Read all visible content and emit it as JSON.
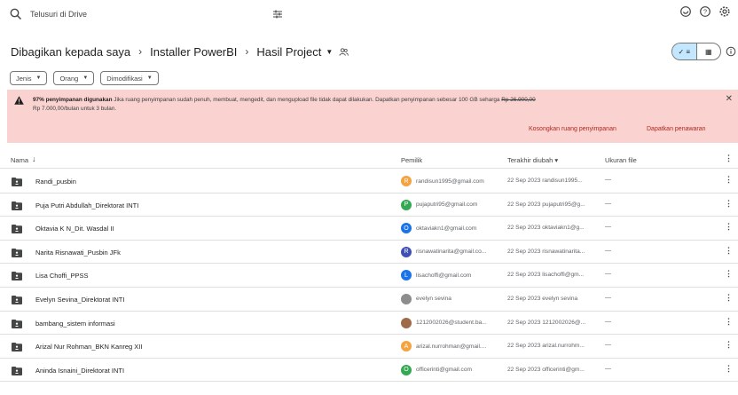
{
  "search": {
    "placeholder": "Telusuri di Drive",
    "icon": "search-icon",
    "filter_icon": "tune-icon"
  },
  "topbar": {
    "icons": [
      "offline-status-icon",
      "help-icon",
      "settings-icon"
    ]
  },
  "breadcrumb": {
    "items": [
      "Dibagikan kepada saya",
      "Installer PowerBI",
      "Hasil Project"
    ],
    "separator": "›"
  },
  "view_toggle": {
    "list_label": "✓ ≡",
    "grid_label": "▦",
    "selected": "list"
  },
  "filters": [
    {
      "label": "Jenis"
    },
    {
      "label": "Orang"
    },
    {
      "label": "Dimodifikasi"
    }
  ],
  "banner": {
    "bold": "97% penyimpanan digunakan",
    "text": " Jika ruang penyimpanan sudah penuh, membuat, mengedit, dan mengupload file tidak dapat dilakukan. Dapatkan penyimpanan sebesar 100 GB seharga ",
    "old_price": "Rp 26.900,00",
    "text2": "Rp 7.000,00/bulan untuk 3 bulan.",
    "action1": "Kosongkan ruang penyimpanan",
    "action2": "Dapatkan penawaran",
    "colors": {
      "background": "#fad2cf",
      "action": "#b3261e"
    }
  },
  "table": {
    "columns": {
      "name": "Nama",
      "owner": "Pemilik",
      "modified": "Terakhir diubah ▾",
      "size": "Ukuran file"
    },
    "rows": [
      {
        "name": "Randi_pusbin",
        "avatar_letter": "R",
        "avatar_color": "#f4a340",
        "owner": "randisun1995@gmail.com",
        "modified": "22 Sep 2023 randisun1995...",
        "size": "—"
      },
      {
        "name": "Puja Putri Abdullah_Direktorat INTI",
        "avatar_letter": "P",
        "avatar_color": "#34a853",
        "owner": "pujaputri95@gmail.com",
        "modified": "22 Sep 2023 pujaputri95@g...",
        "size": "—"
      },
      {
        "name": "Oktavia K N_Dit. Wasdal II",
        "avatar_letter": "O",
        "avatar_color": "#1a73e8",
        "owner": "oktaviakn1@gmail.com",
        "modified": "22 Sep 2023 oktaviakn1@g...",
        "size": "—"
      },
      {
        "name": "Narita Risnawati_Pusbin JFk",
        "avatar_letter": "R",
        "avatar_color": "#3f51b5",
        "owner": "risnawatinarita@gmail.co...",
        "modified": "22 Sep 2023 risnawatinarita...",
        "size": "—"
      },
      {
        "name": "Lisa Choffi_PPSS",
        "avatar_letter": "L",
        "avatar_color": "#1a73e8",
        "owner": "lisachoffi@gmail.com",
        "modified": "22 Sep 2023 lisachoffi@gm...",
        "size": "—"
      },
      {
        "name": "Evelyn Sevina_Direktorat INTI",
        "avatar_letter": "",
        "avatar_color": "#8d8d8d",
        "owner": "evelyn sevina",
        "modified": "22 Sep 2023 evelyn sevina",
        "size": "—"
      },
      {
        "name": "bambang_sistem informasi",
        "avatar_letter": "",
        "avatar_color": "#9e6b4a",
        "owner": "1212002026@student.ba...",
        "modified": "22 Sep 2023 1212002026@...",
        "size": "—"
      },
      {
        "name": "Arizal Nur Rohman_BKN Kanreg XII",
        "avatar_letter": "A",
        "avatar_color": "#f4a340",
        "owner": "arizal.nurrohman@gmail....",
        "modified": "22 Sep 2023 arizal.nurrohm...",
        "size": "—"
      },
      {
        "name": "Aninda Isnaini_Direktorat INTI",
        "avatar_letter": "O",
        "avatar_color": "#34a853",
        "owner": "officerinti@gmail.com",
        "modified": "22 Sep 2023 officerinti@gm...",
        "size": "—"
      }
    ]
  }
}
